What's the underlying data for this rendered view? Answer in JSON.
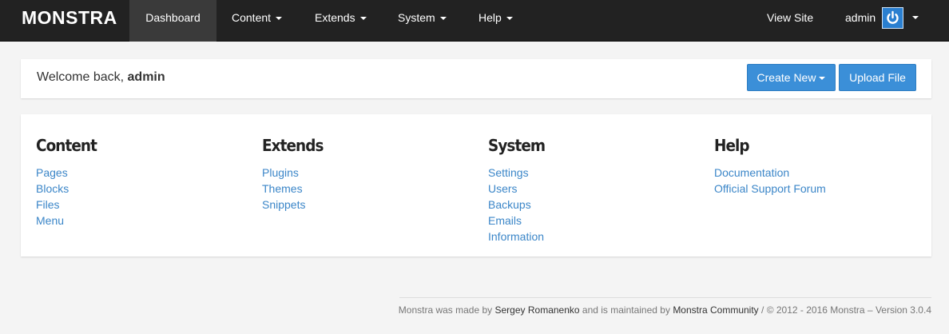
{
  "navbar": {
    "brand": "MONSTRA",
    "items": [
      {
        "label": "Dashboard"
      },
      {
        "label": "Content"
      },
      {
        "label": "Extends"
      },
      {
        "label": "System"
      },
      {
        "label": "Help"
      }
    ],
    "view_site": "View Site",
    "user": "admin",
    "avatar_icon": "power-icon",
    "accent": "#2a7fd0"
  },
  "welcome": {
    "prefix": "Welcome back, ",
    "username": "admin"
  },
  "actions": {
    "create_new": "Create New",
    "upload_file": "Upload File",
    "button_color": "#3b8fd8"
  },
  "sections": [
    {
      "title": "Content",
      "links": [
        "Pages",
        "Blocks",
        "Files",
        "Menu"
      ]
    },
    {
      "title": "Extends",
      "links": [
        "Plugins",
        "Themes",
        "Snippets"
      ]
    },
    {
      "title": "System",
      "links": [
        "Settings",
        "Users",
        "Backups",
        "Emails",
        "Information"
      ]
    },
    {
      "title": "Help",
      "links": [
        "Documentation",
        "Official Support Forum"
      ]
    }
  ],
  "footer": {
    "made_by_prefix": "Monstra was made by ",
    "author": "Sergey Romanenko",
    "maintained_text": " and is maintained by ",
    "community": "Monstra Community",
    "suffix": " / © 2012 - 2016 Monstra – Version 3.0.4"
  }
}
